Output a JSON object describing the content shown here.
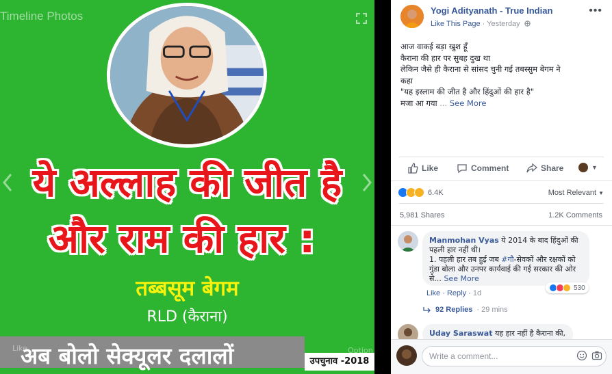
{
  "photo": {
    "header": "Timeline Photos",
    "headline_line1": "ये अल्लाह की जीत है",
    "headline_line2": "और राम की हार :",
    "name": "तब्बसूम बेगम",
    "party": "RLD (कैराना)",
    "banner": "अब बोलो सेक्यूलर दलालों",
    "election_tag": "उपचुनाव -2018",
    "ghost_like": "Like",
    "ghost_options": "Option"
  },
  "post": {
    "page_name": "Yogi Adityanath - True Indian",
    "like_page": "Like This Page",
    "separator": " · ",
    "timestamp": "Yesterday",
    "lines": [
      "आज वाकई बड़ा खुश हूँ",
      "कैराना की हार पर सुबह दुख था",
      "लेकिन जैसे ही कैराना से सांसद चुनी गई तबस्सुम बेगम ने",
      "कहा",
      "\"यह इस्लाम की जीत है और हिंदुओं की हार है\"",
      "मजा आ गया"
    ],
    "ellipsis": " ... ",
    "see_more": "See More"
  },
  "actions": {
    "like": "Like",
    "comment": "Comment",
    "share": "Share"
  },
  "reactions": {
    "count": "6.4K",
    "most_relevant": "Most Relevant"
  },
  "stats": {
    "shares": "5,981 Shares",
    "comments": "1.2K Comments"
  },
  "comments": [
    {
      "author": "Manmohan Vyas",
      "text_start": " ये 2014 के बाद हिंदुओं की पहली हार नहीं थी।",
      "text_mid": "1. पहली हार तब हुई जब ",
      "hashtag": "#गौ",
      "text_end": "-सेवकों और रक्षकों को गुंडा बोला और उनपर कार्यवाई की गई सरकार की ओर से...",
      "see_more": "See More",
      "like": "Like",
      "reply": "Reply",
      "time": "1d",
      "reaction_count": "530"
    },
    {
      "author": "Uday Saraswat",
      "text_start": " यह हार नहीं है कैराना की,"
    }
  ],
  "replies": {
    "label": "92 Replies",
    "time": "29 mins"
  },
  "write_comment": {
    "placeholder": "Write a comment..."
  },
  "colors": {
    "photo_bg": "#2db431",
    "headline": "#e8161a",
    "name": "#f5f30d",
    "link": "#365899",
    "like": "#1877f2",
    "love": "#f33e58",
    "haha": "#f7b125"
  }
}
